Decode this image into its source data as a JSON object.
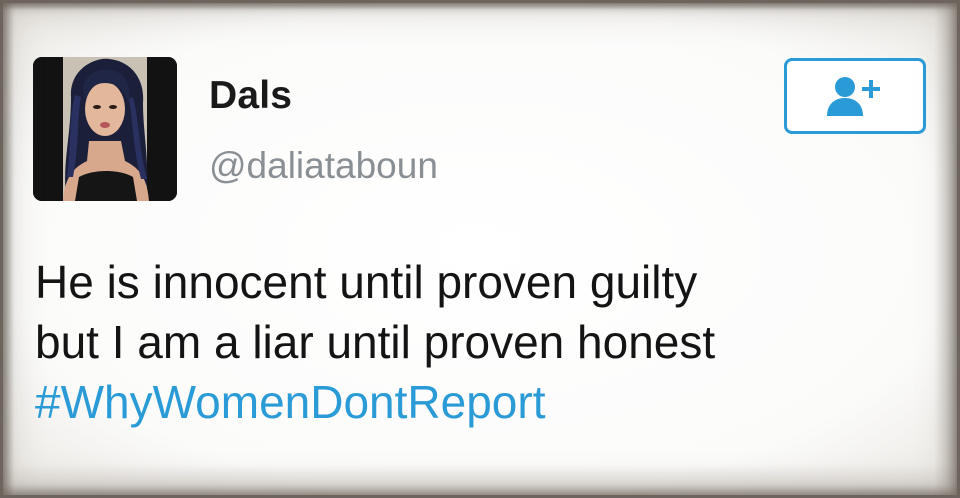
{
  "tweet": {
    "display_name": "Dals",
    "handle": "@daliataboun",
    "text_lines": [
      "He is innocent until proven guilty",
      "but I am a liar until proven honest"
    ],
    "hashtag": "#WhyWomenDontReport"
  },
  "follow_button": {
    "icon": "add-user-icon"
  },
  "colors": {
    "accent": "#2a9bd6",
    "text": "#141414",
    "handle": "#8a8f94"
  }
}
